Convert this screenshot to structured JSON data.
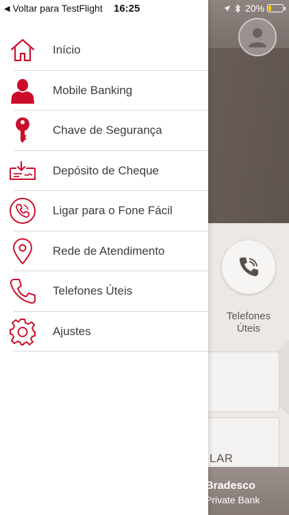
{
  "status_bar": {
    "back_label": "Voltar para TestFlight",
    "time": "16:25",
    "battery": "20%",
    "battery_level": 0.2
  },
  "menu": {
    "items": [
      {
        "label": "Início",
        "icon": "home-icon"
      },
      {
        "label": "Mobile Banking",
        "icon": "person-icon"
      },
      {
        "label": "Chave de Segurança",
        "icon": "key-icon"
      },
      {
        "label": "Depósito de Cheque",
        "icon": "check-deposit-icon"
      },
      {
        "label": "Ligar para o Fone Fácil",
        "icon": "phone-circle-icon"
      },
      {
        "label": "Rede de Atendimento",
        "icon": "location-pin-icon"
      },
      {
        "label": "Telefones Úteis",
        "icon": "phone-icon"
      },
      {
        "label": "Ajustes",
        "icon": "gear-icon"
      }
    ]
  },
  "background": {
    "phone_label": "Telefones Úteis",
    "card_text": "LAR",
    "brand_name": "Bradesco",
    "brand_sub": "Private Bank"
  },
  "colors": {
    "accent": "#cc0d2a",
    "text": "#3b3b3b",
    "divider": "#d8d8d8"
  }
}
